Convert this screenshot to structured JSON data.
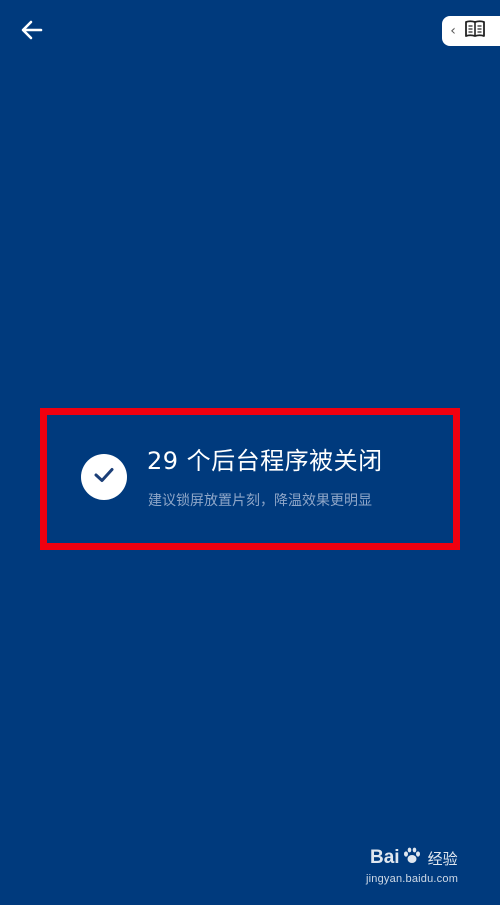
{
  "header": {
    "back_icon": "arrow-left-icon",
    "reader_chevron": "‹",
    "reader_icon": "open-book-icon"
  },
  "result": {
    "title": "29 个后台程序被关闭",
    "subtitle": "建议锁屏放置片刻，降温效果更明显",
    "status_icon": "check-icon"
  },
  "watermark": {
    "brand_prefix": "Bai",
    "brand_suffix": "经验",
    "url": "jingyan.baidu.com"
  },
  "colors": {
    "background": "#003a7d",
    "highlight_border": "#f0000f",
    "subtitle": "#8ea6c8"
  }
}
